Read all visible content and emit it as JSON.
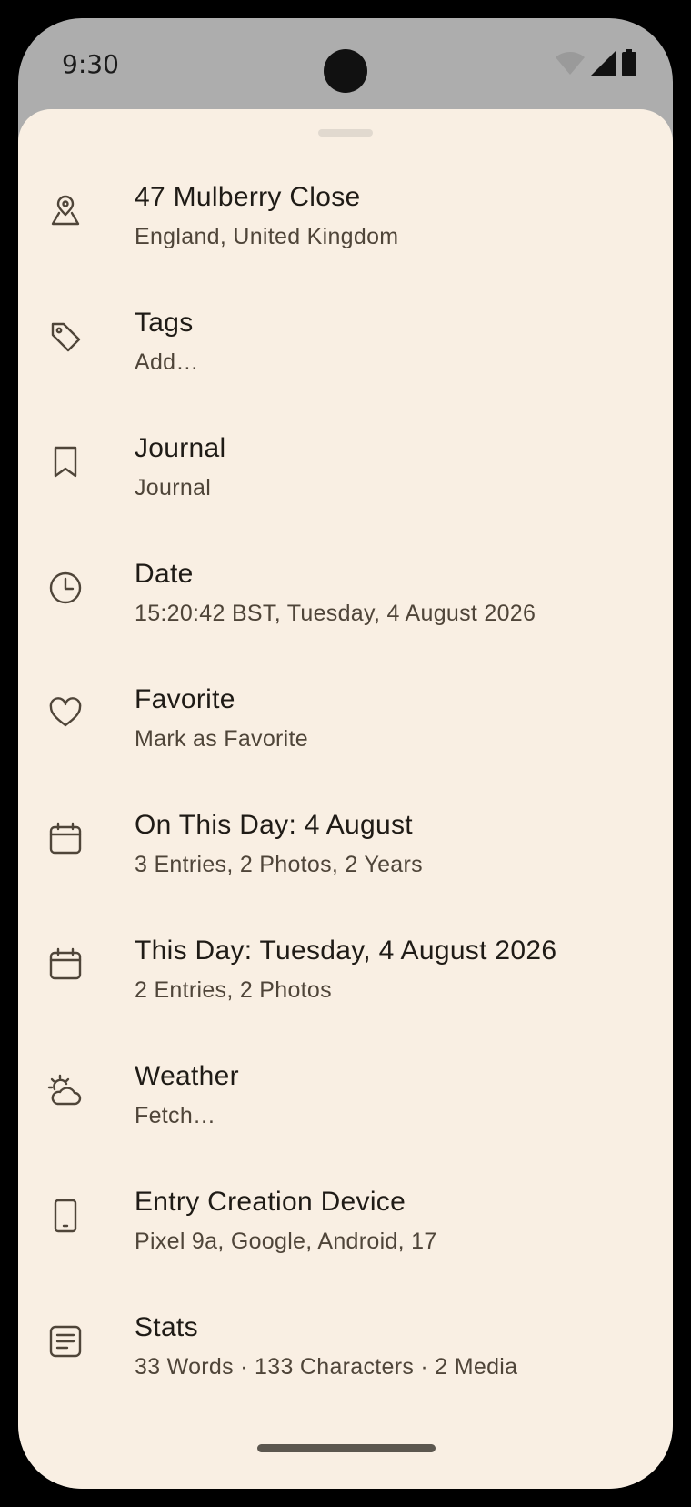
{
  "status_bar": {
    "time": "9:30",
    "icons": [
      "wifi-icon",
      "signal-icon",
      "battery-icon"
    ]
  },
  "colors": {
    "sheet_background": "#f9efe3",
    "status_background": "#adadad",
    "title_text": "#1f1b16",
    "subtitle_text": "#4f4539",
    "icon_stroke": "#4f4539"
  },
  "details": [
    {
      "icon": "location-icon",
      "title": "47 Mulberry Close",
      "subtitle": "England, United Kingdom"
    },
    {
      "icon": "tag-icon",
      "title": "Tags",
      "subtitle": "Add…"
    },
    {
      "icon": "bookmark-icon",
      "title": "Journal",
      "subtitle": "Journal"
    },
    {
      "icon": "clock-icon",
      "title": "Date",
      "subtitle": "15:20:42 BST, Tuesday, 4 August 2026"
    },
    {
      "icon": "heart-icon",
      "title": "Favorite",
      "subtitle": "Mark as Favorite"
    },
    {
      "icon": "calendar-icon",
      "title": "On This Day: 4 August",
      "subtitle": "3 Entries, 2 Photos, 2 Years"
    },
    {
      "icon": "calendar-icon",
      "title": "This Day: Tuesday, 4 August 2026",
      "subtitle": "2 Entries, 2 Photos"
    },
    {
      "icon": "weather-icon",
      "title": "Weather",
      "subtitle": "Fetch…"
    },
    {
      "icon": "phone-icon",
      "title": "Entry Creation Device",
      "subtitle": "Pixel 9a, Google, Android, 17"
    },
    {
      "icon": "stats-icon",
      "title": "Stats",
      "subtitle": "33 Words · 133 Characters · 2 Media"
    }
  ]
}
